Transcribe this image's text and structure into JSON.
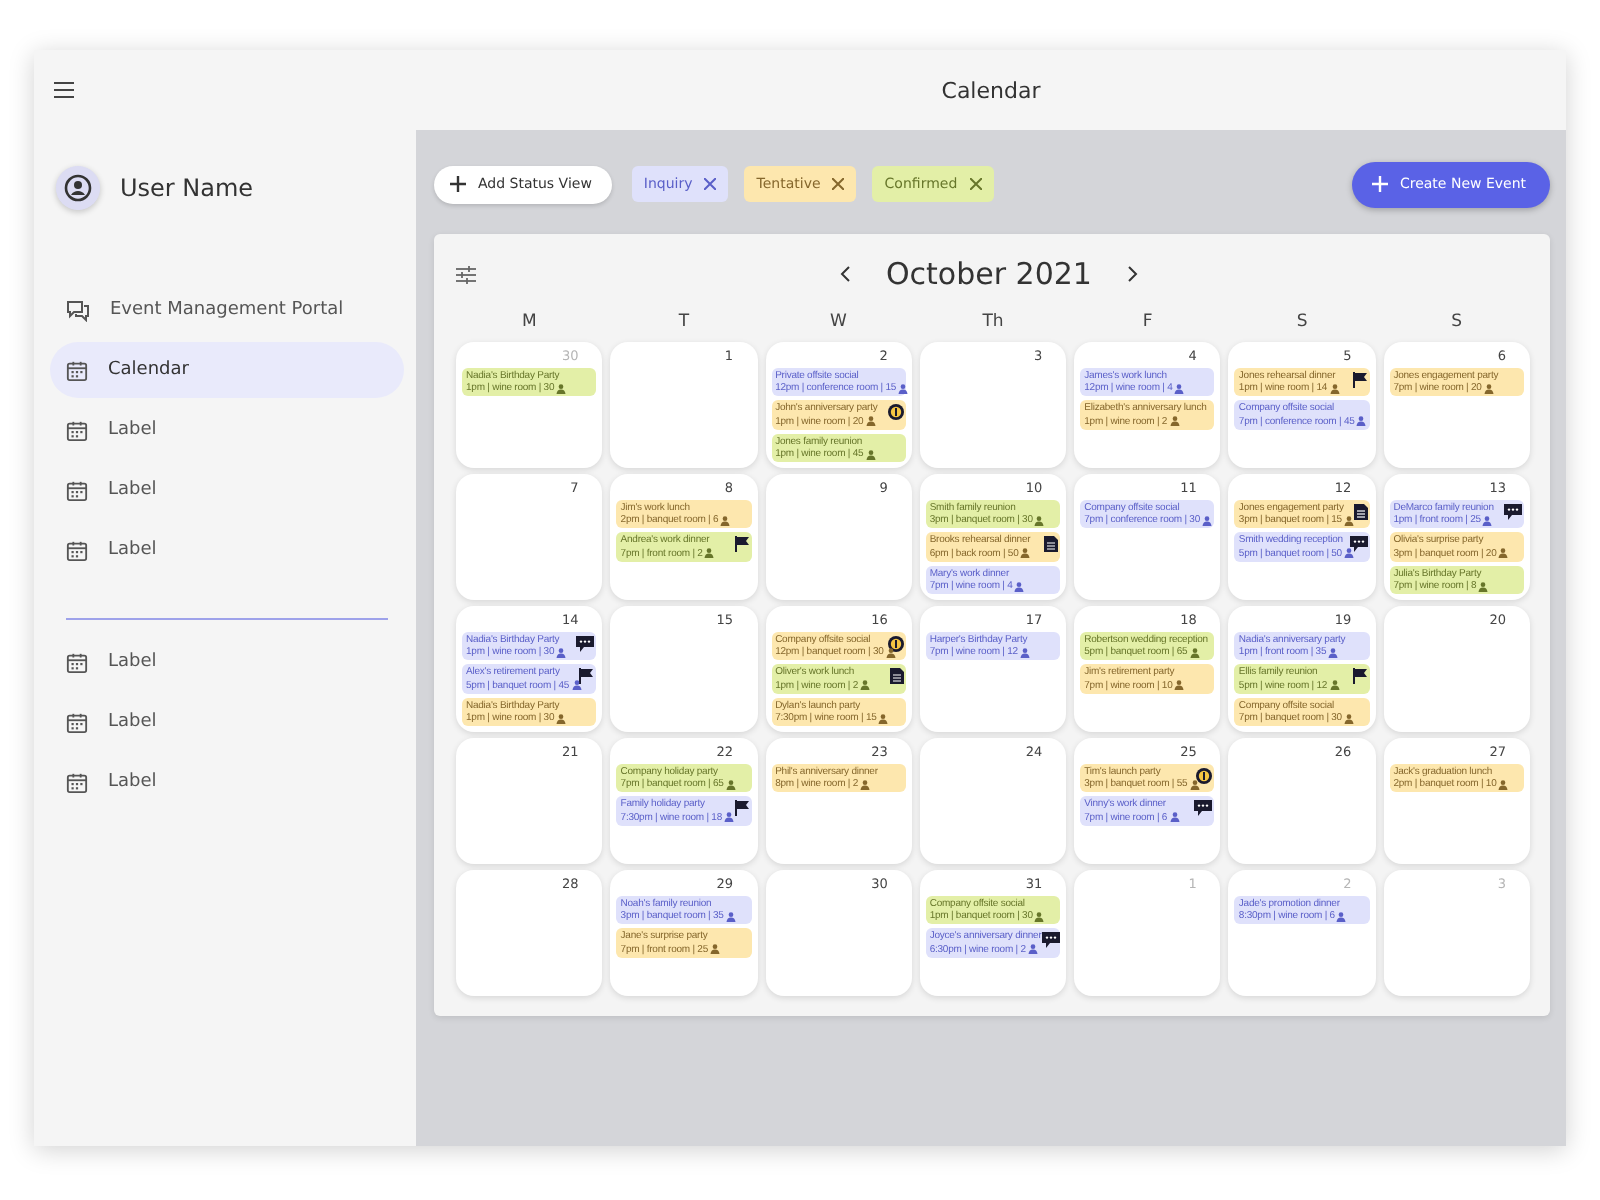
{
  "header": {
    "title": "Calendar"
  },
  "sidebar": {
    "user_name": "User Name",
    "groups": [
      {
        "items": [
          {
            "label": "Event Management Portal",
            "kind": "chat",
            "selected": false
          },
          {
            "label": "Calendar",
            "kind": "calendar",
            "selected": true
          },
          {
            "label": "Label",
            "kind": "calendar",
            "selected": false
          },
          {
            "label": "Label",
            "kind": "calendar",
            "selected": false
          },
          {
            "label": "Label",
            "kind": "calendar",
            "selected": false
          }
        ]
      },
      {
        "items": [
          {
            "label": "Label",
            "kind": "calendar",
            "selected": false
          },
          {
            "label": "Label",
            "kind": "calendar",
            "selected": false
          },
          {
            "label": "Label",
            "kind": "calendar",
            "selected": false
          }
        ]
      }
    ]
  },
  "toolbar": {
    "add_button": "Add Status View",
    "filters": [
      {
        "label": "Inquiry",
        "color": "#dfe1fb"
      },
      {
        "label": "Tentative",
        "color": "#fde7ae"
      },
      {
        "label": "Confirmed",
        "color": "#e3efa7"
      }
    ],
    "create_button": "Create New Event"
  },
  "calendar": {
    "month": "October 2021",
    "weekdays": [
      "M",
      "T",
      "W",
      "Th",
      "F",
      "S",
      "S"
    ],
    "weeks": [
      {
        "days": [
          {
            "date": "30",
            "muted": true,
            "events": [
              {
                "title": "Nadia's Birthday Party",
                "details": "1pm | wine room | 30",
                "color": "#e3efa7",
                "kind": "plain"
              }
            ]
          },
          {
            "date": "1",
            "muted": false
          },
          {
            "date": "2",
            "muted": false,
            "events": [
              {
                "title": "Private offsite social",
                "details": "12pm | conference room | 15",
                "color": "#dfe1fb",
                "kind": "plain"
              },
              {
                "title": "John's anniversary party",
                "details": "1pm | wine room | 20",
                "color": "#fde7ae",
                "kind": "coin"
              },
              {
                "title": "Jones family reunion",
                "details": "1pm | wine room | 45",
                "color": "#e3efa7",
                "kind": "plain"
              }
            ]
          },
          {
            "date": "3",
            "muted": false
          },
          {
            "date": "4",
            "muted": false,
            "events": [
              {
                "title": "James's work lunch",
                "details": "12pm | wine room | 4",
                "color": "#dfe1fb",
                "kind": "plain"
              },
              {
                "title": "Elizabeth's anniversary lunch",
                "details": "1pm | wine room | 2",
                "color": "#fde7ae",
                "kind": "plain"
              }
            ]
          },
          {
            "date": "5",
            "muted": false,
            "events": [
              {
                "title": "Jones rehearsal dinner",
                "details": "1pm | wine room | 14",
                "color": "#fde7ae",
                "kind": "flag"
              },
              {
                "title": "Company offsite social",
                "details": "7pm | conference room | 45",
                "color": "#dfe1fb",
                "kind": "plain"
              }
            ]
          },
          {
            "date": "6",
            "muted": false,
            "events": [
              {
                "title": "Jones engagement party",
                "details": "7pm | wine room | 20",
                "color": "#fde7ae",
                "kind": "plain"
              }
            ]
          }
        ]
      },
      {
        "days": [
          {
            "date": "7",
            "muted": false
          },
          {
            "date": "8",
            "muted": false,
            "events": [
              {
                "title": "Jim's work lunch",
                "details": "2pm | banquet room | 6",
                "color": "#fde7ae",
                "kind": "plain"
              },
              {
                "title": "Andrea's work dinner",
                "details": "7pm | front room | 2",
                "color": "#e3efa7",
                "kind": "flag"
              }
            ]
          },
          {
            "date": "9",
            "muted": false
          },
          {
            "date": "10",
            "muted": false,
            "events": [
              {
                "title": "Smith family reunion",
                "details": "3pm | banquet room | 30",
                "color": "#e3efa7",
                "kind": "plain"
              },
              {
                "title": "Brooks rehearsal dinner",
                "details": "6pm | back room | 50",
                "color": "#fde7ae",
                "kind": "document"
              },
              {
                "title": "Mary's work dinner",
                "details": "7pm | wine room | 4",
                "color": "#dfe1fb",
                "kind": "plain"
              }
            ]
          },
          {
            "date": "11",
            "muted": false,
            "events": [
              {
                "title": "Company offsite social",
                "details": "7pm | conference room | 30",
                "color": "#dfe1fb",
                "kind": "plain"
              }
            ]
          },
          {
            "date": "12",
            "muted": false,
            "events": [
              {
                "title": "Jones engagement party",
                "details": "3pm | banquet room | 15",
                "color": "#fde7ae",
                "kind": "document"
              },
              {
                "title": "Smith wedding reception",
                "details": "5pm | banquet room | 50",
                "color": "#dfe1fb",
                "kind": "chat"
              }
            ]
          },
          {
            "date": "13",
            "muted": false,
            "events": [
              {
                "title": "DeMarco family reunion",
                "details": "1pm | front room | 25",
                "color": "#dfe1fb",
                "kind": "chat"
              },
              {
                "title": "Olivia's surprise party",
                "details": "3pm | banquet room | 20",
                "color": "#fde7ae",
                "kind": "plain"
              },
              {
                "title": "Julia's Birthday Party",
                "details": "7pm | wine room | 8",
                "color": "#e3efa7",
                "kind": "plain"
              }
            ]
          }
        ]
      },
      {
        "days": [
          {
            "date": "14",
            "muted": false,
            "events": [
              {
                "title": "Nadia's Birthday Party",
                "details": "1pm | wine room | 30",
                "color": "#dfe1fb",
                "kind": "chat"
              },
              {
                "title": "Alex's retirement party",
                "details": "5pm | banquet room | 45",
                "color": "#dfe1fb",
                "kind": "flag"
              },
              {
                "title": "Nadia's Birthday Party",
                "details": "1pm | wine room | 30",
                "color": "#fde7ae",
                "kind": "plain"
              }
            ]
          },
          {
            "date": "15",
            "muted": false
          },
          {
            "date": "16",
            "muted": false,
            "events": [
              {
                "title": "Company offsite social",
                "details": "12pm | banquet room | 30",
                "color": "#fde7ae",
                "kind": "coin"
              },
              {
                "title": "Oliver's work lunch",
                "details": "1pm | wine room | 2",
                "color": "#e3efa7",
                "kind": "document"
              },
              {
                "title": "Dylan's launch party",
                "details": "7:30pm | wine room | 15",
                "color": "#fde7ae",
                "kind": "plain"
              }
            ]
          },
          {
            "date": "17",
            "muted": false,
            "events": [
              {
                "title": "Harper's Birthday Party",
                "details": "7pm | wine room | 12",
                "color": "#dfe1fb",
                "kind": "plain"
              }
            ]
          },
          {
            "date": "18",
            "muted": false,
            "events": [
              {
                "title": "Robertson wedding reception",
                "details": "5pm | banquet room | 65",
                "color": "#e3efa7",
                "kind": "plain"
              },
              {
                "title": "Jim's retirement party",
                "details": "7pm | wine room | 10",
                "color": "#fde7ae",
                "kind": "plain"
              }
            ]
          },
          {
            "date": "19",
            "muted": false,
            "events": [
              {
                "title": "Nadia's anniversary party",
                "details": "1pm | front room | 35",
                "color": "#dfe1fb",
                "kind": "plain"
              },
              {
                "title": "Ellis family reunion",
                "details": "5pm | wine room | 12",
                "color": "#e3efa7",
                "kind": "flag"
              },
              {
                "title": "Company offsite social",
                "details": "7pm | banquet room | 30",
                "color": "#fde7ae",
                "kind": "plain"
              }
            ]
          },
          {
            "date": "20",
            "muted": false
          }
        ]
      },
      {
        "days": [
          {
            "date": "21",
            "muted": false
          },
          {
            "date": "22",
            "muted": false,
            "events": [
              {
                "title": "Company holiday party",
                "details": "7pm | banquet room | 65",
                "color": "#e3efa7",
                "kind": "plain"
              },
              {
                "title": "Family holiday party",
                "details": "7:30pm | wine room | 18",
                "color": "#dfe1fb",
                "kind": "flag"
              }
            ]
          },
          {
            "date": "23",
            "muted": false,
            "events": [
              {
                "title": "Phil's anniversary dinner",
                "details": "8pm | wine room | 2",
                "color": "#fde7ae",
                "kind": "plain"
              }
            ]
          },
          {
            "date": "24",
            "muted": false
          },
          {
            "date": "25",
            "muted": false,
            "events": [
              {
                "title": "Tim's launch party",
                "details": "3pm | banquet room | 55",
                "color": "#fde7ae",
                "kind": "coin"
              },
              {
                "title": "Vinny's work dinner",
                "details": "7pm | wine room | 6",
                "color": "#dfe1fb",
                "kind": "chat"
              }
            ]
          },
          {
            "date": "26",
            "muted": false
          },
          {
            "date": "27",
            "muted": false,
            "events": [
              {
                "title": "Jack's graduation lunch",
                "details": "2pm | banquet room | 10",
                "color": "#fde7ae",
                "kind": "plain"
              }
            ]
          }
        ]
      },
      {
        "days": [
          {
            "date": "28",
            "muted": false
          },
          {
            "date": "29",
            "muted": false,
            "events": [
              {
                "title": "Noah's family reunion",
                "details": "3pm | banquet room | 35",
                "color": "#dfe1fb",
                "kind": "plain"
              },
              {
                "title": "Jane's surprise party",
                "details": "7pm | front room | 25",
                "color": "#fde7ae",
                "kind": "plain"
              }
            ]
          },
          {
            "date": "30",
            "muted": false
          },
          {
            "date": "31",
            "muted": false,
            "events": [
              {
                "title": "Company offsite social",
                "details": "1pm | banquet room | 30",
                "color": "#e3efa7",
                "kind": "plain"
              },
              {
                "title": "Joyce's anniversary dinner",
                "details": "6:30pm | wine room | 2",
                "color": "#dfe1fb",
                "kind": "chat"
              }
            ]
          },
          {
            "date": "1",
            "muted": true
          },
          {
            "date": "2",
            "muted": true,
            "events": [
              {
                "title": "Jade's promotion dinner",
                "details": "8:30pm | wine room | 6",
                "color": "#dfe1fb",
                "kind": "plain"
              }
            ]
          },
          {
            "date": "3",
            "muted": true
          }
        ]
      }
    ]
  }
}
